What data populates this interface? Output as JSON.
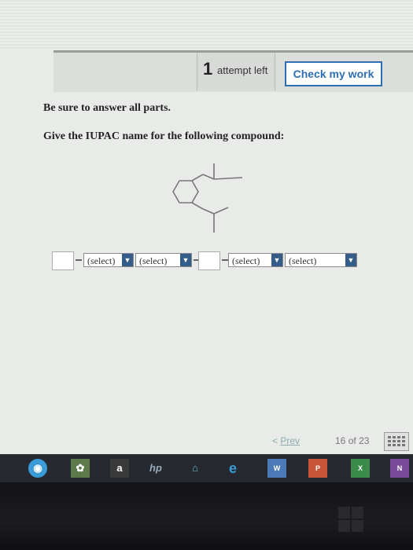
{
  "header": {
    "attempt_number": "1",
    "attempt_text": "attempt left",
    "check_label": "Check my work"
  },
  "content": {
    "instruction": "Be sure to answer all parts.",
    "question": "Give the IUPAC name for the following compound:"
  },
  "answer": {
    "select_1": "(select)",
    "select_2": "(select)",
    "select_3": "(select)",
    "select_4": "(select)"
  },
  "navigation": {
    "prev_label": "Prev",
    "page_current": "16",
    "page_of": "of",
    "page_total": "23"
  },
  "taskbar": {
    "icons": [
      "circle-app-icon",
      "photos-icon",
      "amazon-icon",
      "hp-icon",
      "store-icon",
      "edge-icon",
      "word-icon",
      "powerpoint-icon",
      "excel-icon",
      "onenote-icon"
    ]
  }
}
